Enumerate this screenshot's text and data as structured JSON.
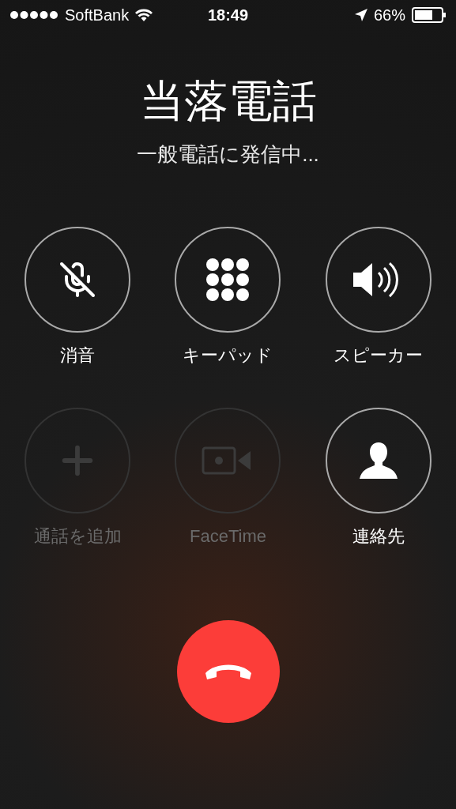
{
  "status_bar": {
    "carrier": "SoftBank",
    "time": "18:49",
    "battery": "66%"
  },
  "call": {
    "name": "当落電話",
    "status": "一般電話に発信中..."
  },
  "buttons": [
    {
      "kind": "mute",
      "label": "消音",
      "disabled": false
    },
    {
      "kind": "keypad",
      "label": "キーパッド",
      "disabled": false
    },
    {
      "kind": "speaker",
      "label": "スピーカー",
      "disabled": false
    },
    {
      "kind": "add",
      "label": "通話を追加",
      "disabled": true
    },
    {
      "kind": "facetime",
      "label": "FaceTime",
      "disabled": true
    },
    {
      "kind": "contacts",
      "label": "連絡先",
      "disabled": false
    }
  ]
}
